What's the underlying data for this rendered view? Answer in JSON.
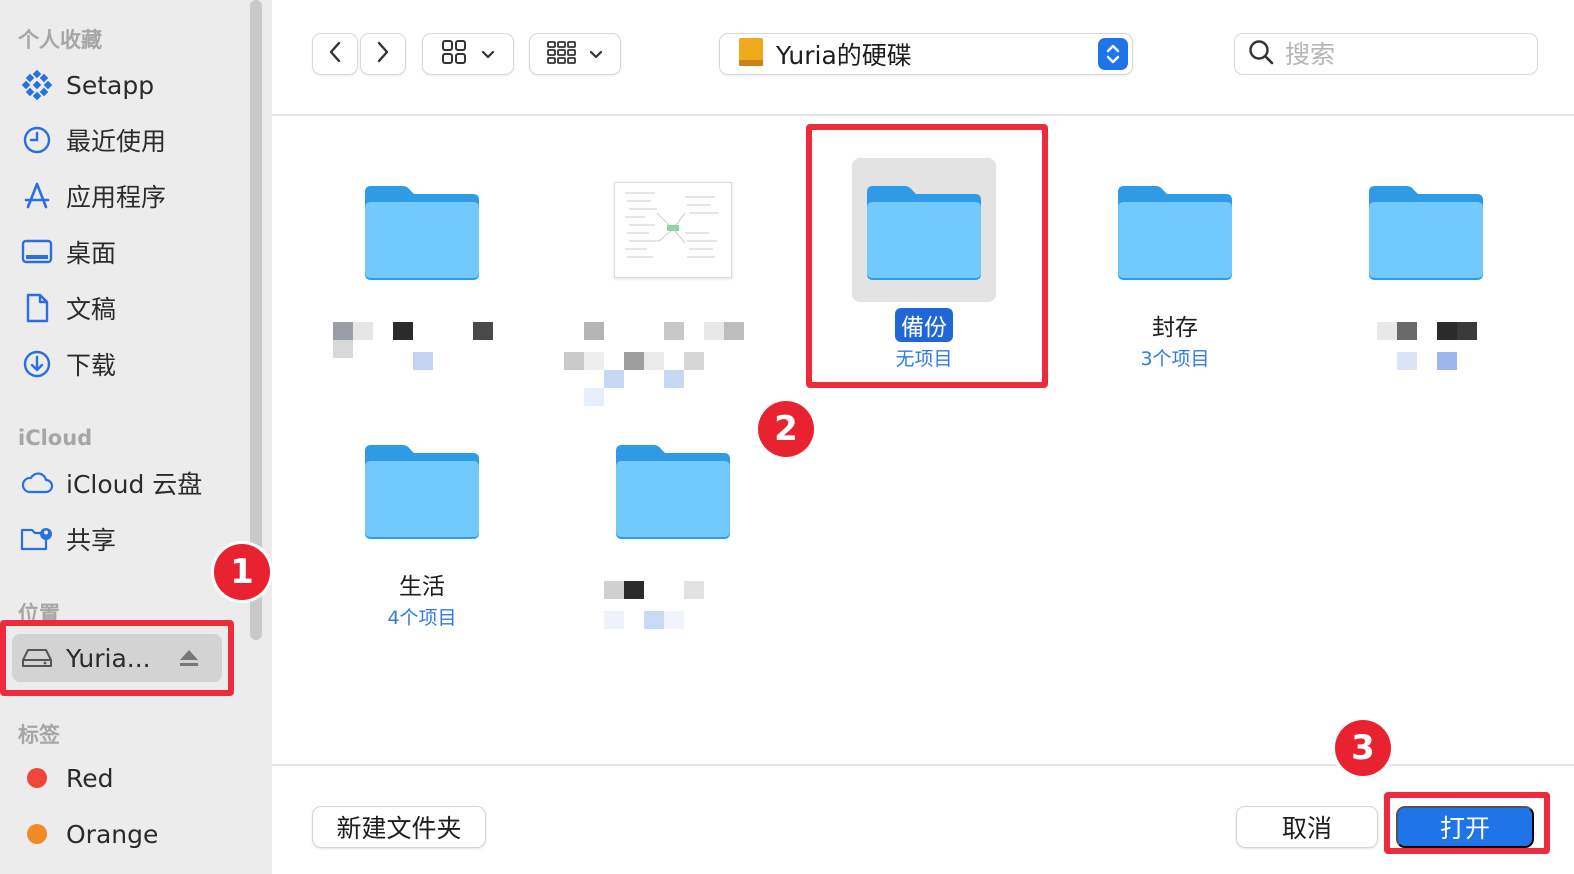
{
  "sidebar": {
    "favorites_header": "个人收藏",
    "favorites": [
      {
        "label": "Setapp",
        "icon": "setapp-icon"
      },
      {
        "label": "最近使用",
        "icon": "clock-icon"
      },
      {
        "label": "应用程序",
        "icon": "apps-icon"
      },
      {
        "label": "桌面",
        "icon": "desktop-icon"
      },
      {
        "label": "文稿",
        "icon": "document-icon"
      },
      {
        "label": "下载",
        "icon": "download-icon"
      }
    ],
    "icloud_header": "iCloud",
    "icloud": [
      {
        "label": "iCloud 云盘",
        "icon": "cloud-icon"
      },
      {
        "label": "共享",
        "icon": "shared-folder-icon"
      }
    ],
    "locations_header": "位置",
    "locations": [
      {
        "label": "Yuria...",
        "icon": "drive-icon",
        "selected": true
      }
    ],
    "tags_header": "标签",
    "tags": [
      {
        "label": "Red",
        "color": "#f2463a"
      },
      {
        "label": "Orange",
        "color": "#f08a24"
      }
    ]
  },
  "toolbar": {
    "path": "Yuria的硬碟",
    "search_placeholder": "搜索"
  },
  "files": [
    {
      "name": "",
      "sub": "",
      "kind": "folder",
      "selected": false
    },
    {
      "name": "",
      "sub": "",
      "kind": "document",
      "selected": false
    },
    {
      "name": "備份",
      "sub": "无项目",
      "kind": "folder",
      "selected": true
    },
    {
      "name": "封存",
      "sub": "3个项目",
      "kind": "folder",
      "selected": false
    },
    {
      "name": "",
      "sub": "",
      "kind": "folder",
      "selected": false
    },
    {
      "name": "生活",
      "sub": "4个项目",
      "kind": "folder",
      "selected": false
    },
    {
      "name": "",
      "sub": "",
      "kind": "folder",
      "selected": false
    }
  ],
  "bottom": {
    "new_folder": "新建文件夹",
    "cancel": "取消",
    "open": "打开"
  },
  "annotations": {
    "badge1": "1",
    "badge2": "2",
    "badge3": "3",
    "color": "#ee2b3c"
  }
}
